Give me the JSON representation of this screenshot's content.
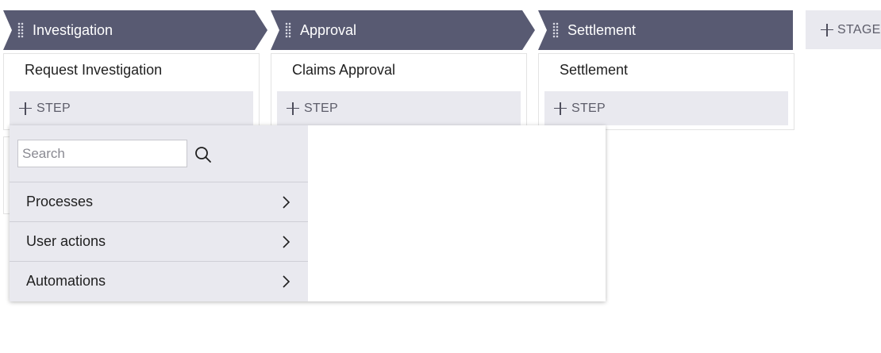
{
  "stages": [
    {
      "title": "Investigation",
      "step": "Request Investigation",
      "add_step": "STEP"
    },
    {
      "title": "Approval",
      "step": "Claims Approval",
      "add_step": "STEP"
    },
    {
      "title": "Settlement",
      "step": "Settlement",
      "add_step": "STEP"
    }
  ],
  "add_stage_label": "STAGE",
  "popover": {
    "search_placeholder": "Search",
    "search_value": "",
    "items": [
      {
        "label": "Processes",
        "icon": "chevron-right-icon"
      },
      {
        "label": "User actions",
        "icon": "chevron-right-icon"
      },
      {
        "label": "Automations",
        "icon": "chevron-right-icon"
      }
    ]
  },
  "colors": {
    "stage_header": "#585a72",
    "panel_gray": "#e9e9ef",
    "text": "#1f1f1f"
  }
}
